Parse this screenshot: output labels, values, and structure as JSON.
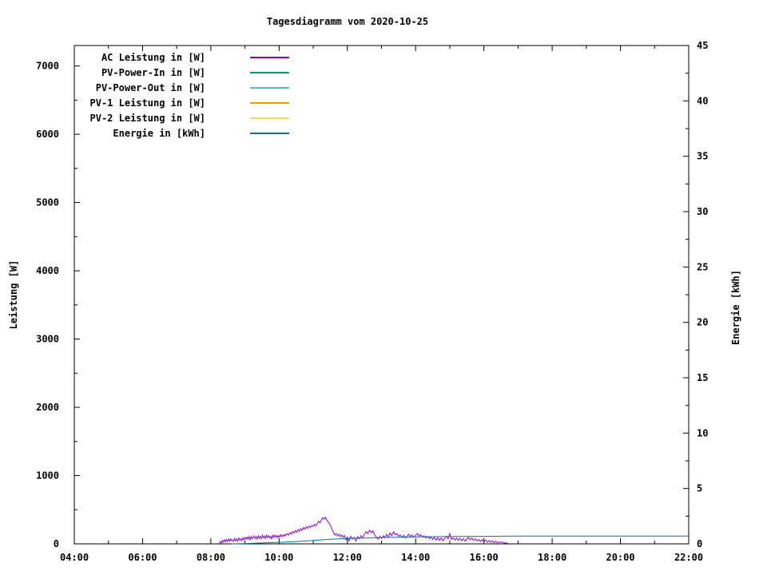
{
  "title": "Tagesdiagramm vom 2020-10-25",
  "axes": {
    "x": {
      "start": 4,
      "end": 22,
      "major": 2,
      "minor": 1,
      "labels": [
        "04:00",
        "06:00",
        "08:00",
        "10:00",
        "12:00",
        "14:00",
        "16:00",
        "18:00",
        "20:00",
        "22:00"
      ]
    },
    "y_left": {
      "label": "Leistung [W]",
      "min": 0,
      "max": 7300,
      "major": 1000,
      "minor": 500,
      "labels": [
        "0",
        "1000",
        "2000",
        "3000",
        "4000",
        "5000",
        "6000",
        "7000"
      ]
    },
    "y_right": {
      "label": "Energie [kWh]",
      "min": 0,
      "max": 45,
      "major": 5,
      "minor": 2.5,
      "labels": [
        "0",
        "5",
        "10",
        "15",
        "20",
        "25",
        "30",
        "35",
        "40",
        "45"
      ]
    }
  },
  "legend": [
    {
      "label": "AC Leistung in [W]",
      "color": "#9400d3"
    },
    {
      "label": "PV-Power-In in [W]",
      "color": "#009e73"
    },
    {
      "label": "PV-Power-Out in [W]",
      "color": "#56b4e9"
    },
    {
      "label": "PV-1 Leistung in [W]",
      "color": "#e69f00"
    },
    {
      "label": "PV-2 Leistung in [W]",
      "color": "#f0e442"
    },
    {
      "label": "Energie in [kWh]",
      "color": "#0072b2"
    }
  ],
  "chart_data": {
    "type": "line",
    "title": "Tagesdiagramm vom 2020-10-25",
    "xlabel": "",
    "ylabel": "Leistung [W]",
    "y2label": "Energie [kWh]",
    "x_range_hours": [
      4,
      22
    ],
    "ylim_left": [
      0,
      7300
    ],
    "ylim_right": [
      0,
      45
    ],
    "grid": false,
    "legend_position": "top-left-inside",
    "series": [
      {
        "name": "AC Leistung in [W]",
        "color": "#9400d3",
        "axis": "left",
        "visible": true,
        "points": [
          [
            8.25,
            5
          ],
          [
            8.28,
            35
          ],
          [
            8.31,
            15
          ],
          [
            8.34,
            50
          ],
          [
            8.37,
            25
          ],
          [
            8.4,
            60
          ],
          [
            8.43,
            30
          ],
          [
            8.46,
            65
          ],
          [
            8.49,
            35
          ],
          [
            8.52,
            70
          ],
          [
            8.55,
            40
          ],
          [
            8.58,
            75
          ],
          [
            8.61,
            45
          ],
          [
            8.64,
            60
          ],
          [
            8.67,
            35
          ],
          [
            8.7,
            80
          ],
          [
            8.73,
            50
          ],
          [
            8.76,
            70
          ],
          [
            8.79,
            40
          ],
          [
            8.82,
            85
          ],
          [
            8.85,
            55
          ],
          [
            8.88,
            75
          ],
          [
            8.91,
            45
          ],
          [
            8.94,
            90
          ],
          [
            8.97,
            60
          ],
          [
            9.0,
            95
          ],
          [
            9.03,
            65
          ],
          [
            9.06,
            100
          ],
          [
            9.09,
            70
          ],
          [
            9.12,
            105
          ],
          [
            9.15,
            60
          ],
          [
            9.18,
            110
          ],
          [
            9.21,
            75
          ],
          [
            9.24,
            95
          ],
          [
            9.27,
            115
          ],
          [
            9.3,
            80
          ],
          [
            9.33,
            105
          ],
          [
            9.36,
            70
          ],
          [
            9.39,
            120
          ],
          [
            9.42,
            85
          ],
          [
            9.45,
            110
          ],
          [
            9.48,
            75
          ],
          [
            9.51,
            125
          ],
          [
            9.54,
            90
          ],
          [
            9.57,
            115
          ],
          [
            9.6,
            80
          ],
          [
            9.63,
            130
          ],
          [
            9.66,
            95
          ],
          [
            9.69,
            120
          ],
          [
            9.72,
            85
          ],
          [
            9.75,
            110
          ],
          [
            9.78,
            75
          ],
          [
            9.81,
            125
          ],
          [
            9.84,
            95
          ],
          [
            9.87,
            130
          ],
          [
            9.9,
            100
          ],
          [
            9.93,
            120
          ],
          [
            9.96,
            90
          ],
          [
            9.99,
            125
          ],
          [
            10.02,
            100
          ],
          [
            10.05,
            135
          ],
          [
            10.08,
            105
          ],
          [
            10.11,
            130
          ],
          [
            10.14,
            110
          ],
          [
            10.17,
            140
          ],
          [
            10.2,
            120
          ],
          [
            10.24,
            150
          ],
          [
            10.28,
            130
          ],
          [
            10.32,
            165
          ],
          [
            10.36,
            145
          ],
          [
            10.4,
            180
          ],
          [
            10.44,
            160
          ],
          [
            10.48,
            195
          ],
          [
            10.52,
            170
          ],
          [
            10.56,
            210
          ],
          [
            10.6,
            185
          ],
          [
            10.64,
            225
          ],
          [
            10.68,
            200
          ],
          [
            10.72,
            240
          ],
          [
            10.76,
            215
          ],
          [
            10.8,
            250
          ],
          [
            10.84,
            230
          ],
          [
            10.88,
            260
          ],
          [
            10.92,
            240
          ],
          [
            10.96,
            270
          ],
          [
            11.0,
            255
          ],
          [
            11.04,
            285
          ],
          [
            11.08,
            265
          ],
          [
            11.12,
            300
          ],
          [
            11.16,
            330
          ],
          [
            11.2,
            310
          ],
          [
            11.24,
            355
          ],
          [
            11.28,
            385
          ],
          [
            11.32,
            360
          ],
          [
            11.36,
            390
          ],
          [
            11.4,
            350
          ],
          [
            11.44,
            320
          ],
          [
            11.48,
            290
          ],
          [
            11.52,
            250
          ],
          [
            11.56,
            200
          ],
          [
            11.6,
            160
          ],
          [
            11.64,
            130
          ],
          [
            11.68,
            150
          ],
          [
            11.72,
            115
          ],
          [
            11.76,
            140
          ],
          [
            11.8,
            105
          ],
          [
            11.84,
            130
          ],
          [
            11.88,
            95
          ],
          [
            11.92,
            120
          ],
          [
            11.96,
            60
          ],
          [
            12.0,
            100
          ],
          [
            12.05,
            45
          ],
          [
            12.1,
            110
          ],
          [
            12.15,
            70
          ],
          [
            12.2,
            95
          ],
          [
            12.25,
            40
          ],
          [
            12.3,
            105
          ],
          [
            12.35,
            75
          ],
          [
            12.4,
            120
          ],
          [
            12.45,
            90
          ],
          [
            12.5,
            140
          ],
          [
            12.55,
            180
          ],
          [
            12.6,
            150
          ],
          [
            12.65,
            200
          ],
          [
            12.7,
            165
          ],
          [
            12.75,
            190
          ],
          [
            12.8,
            130
          ],
          [
            12.85,
            100
          ],
          [
            12.9,
            70
          ],
          [
            12.95,
            110
          ],
          [
            13.0,
            80
          ],
          [
            13.05,
            120
          ],
          [
            13.1,
            90
          ],
          [
            13.15,
            140
          ],
          [
            13.2,
            100
          ],
          [
            13.25,
            160
          ],
          [
            13.3,
            120
          ],
          [
            13.35,
            175
          ],
          [
            13.4,
            135
          ],
          [
            13.45,
            150
          ],
          [
            13.5,
            110
          ],
          [
            13.55,
            130
          ],
          [
            13.6,
            95
          ],
          [
            13.65,
            125
          ],
          [
            13.7,
            85
          ],
          [
            13.75,
            115
          ],
          [
            13.8,
            140
          ],
          [
            13.85,
            105
          ],
          [
            13.9,
            130
          ],
          [
            13.95,
            95
          ],
          [
            14.0,
            125
          ],
          [
            14.05,
            150
          ],
          [
            14.1,
            115
          ],
          [
            14.15,
            135
          ],
          [
            14.2,
            100
          ],
          [
            14.25,
            120
          ],
          [
            14.3,
            85
          ],
          [
            14.35,
            110
          ],
          [
            14.4,
            75
          ],
          [
            14.45,
            100
          ],
          [
            14.5,
            65
          ],
          [
            14.55,
            95
          ],
          [
            14.6,
            55
          ],
          [
            14.65,
            90
          ],
          [
            14.7,
            50
          ],
          [
            14.75,
            85
          ],
          [
            14.8,
            45
          ],
          [
            14.85,
            80
          ],
          [
            14.9,
            110
          ],
          [
            14.95,
            75
          ],
          [
            15.0,
            150
          ],
          [
            15.05,
            65
          ],
          [
            15.1,
            90
          ],
          [
            15.15,
            55
          ],
          [
            15.2,
            85
          ],
          [
            15.25,
            50
          ],
          [
            15.3,
            80
          ],
          [
            15.35,
            45
          ],
          [
            15.4,
            75
          ],
          [
            15.45,
            40
          ],
          [
            15.5,
            70
          ],
          [
            15.55,
            95
          ],
          [
            15.6,
            60
          ],
          [
            15.65,
            85
          ],
          [
            15.7,
            50
          ],
          [
            15.75,
            75
          ],
          [
            15.8,
            40
          ],
          [
            15.85,
            65
          ],
          [
            15.9,
            35
          ],
          [
            15.95,
            60
          ],
          [
            16.0,
            30
          ],
          [
            16.05,
            55
          ],
          [
            16.1,
            25
          ],
          [
            16.15,
            50
          ],
          [
            16.2,
            20
          ],
          [
            16.25,
            45
          ],
          [
            16.3,
            15
          ],
          [
            16.35,
            40
          ],
          [
            16.4,
            10
          ],
          [
            16.45,
            30
          ],
          [
            16.5,
            20
          ],
          [
            16.55,
            25
          ],
          [
            16.6,
            10
          ],
          [
            16.65,
            15
          ],
          [
            16.7,
            5
          ]
        ]
      },
      {
        "name": "PV-Power-In in [W]",
        "color": "#009e73",
        "axis": "left",
        "visible": false,
        "points": []
      },
      {
        "name": "PV-Power-Out in [W]",
        "color": "#56b4e9",
        "axis": "left",
        "visible": false,
        "points": []
      },
      {
        "name": "PV-1 Leistung in [W]",
        "color": "#e69f00",
        "axis": "left",
        "visible": false,
        "points": []
      },
      {
        "name": "PV-2 Leistung in [W]",
        "color": "#f0e442",
        "axis": "left",
        "visible": false,
        "points": []
      },
      {
        "name": "Energie in [kWh]",
        "color": "#0072b2",
        "axis": "right",
        "visible": true,
        "points": [
          [
            8.6,
            0.0
          ],
          [
            9.0,
            0.03
          ],
          [
            9.5,
            0.08
          ],
          [
            10.0,
            0.14
          ],
          [
            10.5,
            0.21
          ],
          [
            11.0,
            0.3
          ],
          [
            11.3,
            0.37
          ],
          [
            11.6,
            0.43
          ],
          [
            12.0,
            0.48
          ],
          [
            12.5,
            0.53
          ],
          [
            13.0,
            0.57
          ],
          [
            13.5,
            0.6
          ],
          [
            14.0,
            0.63
          ],
          [
            14.5,
            0.65
          ],
          [
            15.0,
            0.66
          ],
          [
            15.5,
            0.67
          ],
          [
            16.0,
            0.68
          ],
          [
            16.5,
            0.69
          ],
          [
            17.0,
            0.7
          ],
          [
            22.0,
            0.7
          ]
        ]
      }
    ]
  }
}
